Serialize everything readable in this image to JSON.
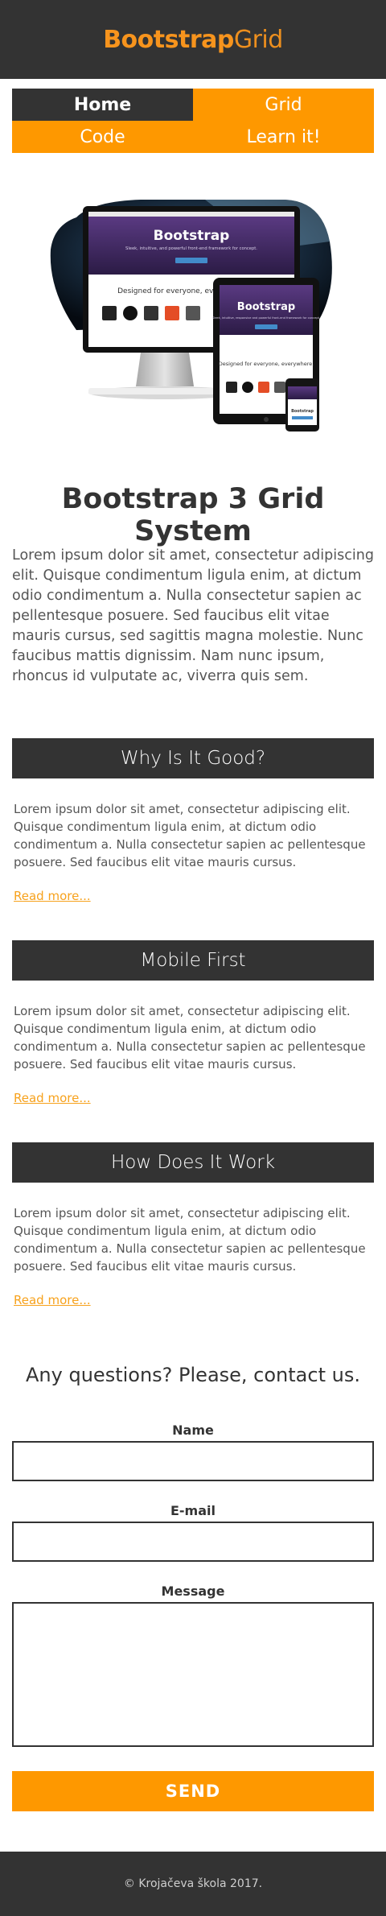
{
  "header": {
    "brand_bold": "Bootstrap",
    "brand_light": "Grid"
  },
  "nav": {
    "items": [
      {
        "label": "Home",
        "active": true
      },
      {
        "label": "Grid",
        "active": false
      },
      {
        "label": "Code",
        "active": false
      },
      {
        "label": "Learn it!",
        "active": false
      }
    ]
  },
  "hero": {
    "monitor_title": "Bootstrap",
    "monitor_subtitle": "Sleek, intuitive, and powerful front-end framework for concept.",
    "monitor_tagline": "Designed for everyone, every",
    "tablet_title": "Bootstrap",
    "tablet_subtitle": "Sleek, intuitive, responsive and powerful front-end framework for concept.",
    "tablet_tagline": "Designed for everyone, everywhere.",
    "phone_title": "Bootstrap"
  },
  "main": {
    "title": "Bootstrap 3 Grid System",
    "intro": "Lorem ipsum dolor sit amet, consectetur adipiscing elit. Quisque condimentum ligula enim, at dictum odio condimentum a. Nulla consectetur sapien ac pellentesque posuere. Sed faucibus elit vitae mauris cursus, sed sagittis magna molestie. Nunc faucibus mattis dignissim. Nam nunc ipsum, rhoncus id vulputate ac, viverra quis sem."
  },
  "sections": [
    {
      "title": "Why Is It Good?",
      "text": "Lorem ipsum dolor sit amet, consectetur adipiscing elit. Quisque condimentum ligula enim, at dictum odio condimentum a. Nulla consectetur sapien ac pellentesque posuere. Sed faucibus elit vitae mauris cursus.",
      "link": "Read more..."
    },
    {
      "title": "Mobile First",
      "text": "Lorem ipsum dolor sit amet, consectetur adipiscing elit. Quisque condimentum ligula enim, at dictum odio condimentum a. Nulla consectetur sapien ac pellentesque posuere. Sed faucibus elit vitae mauris cursus.",
      "link": "Read more..."
    },
    {
      "title": "How Does It Work",
      "text": "Lorem ipsum dolor sit amet, consectetur adipiscing elit. Quisque condimentum ligula enim, at dictum odio condimentum a. Nulla consectetur sapien ac pellentesque posuere. Sed faucibus elit vitae mauris cursus.",
      "link": "Read more..."
    }
  ],
  "contact": {
    "title": "Any questions? Please, contact us.",
    "name_label": "Name",
    "name_value": "",
    "email_label": "E-mail",
    "email_value": "",
    "message_label": "Message",
    "message_value": "",
    "send_label": "SEND"
  },
  "footer": {
    "text": "© Krojačeva škola 2017."
  },
  "colors": {
    "dark": "#333333",
    "accent": "#fe9800",
    "brand": "#f7941d",
    "link": "#f7a21d"
  }
}
